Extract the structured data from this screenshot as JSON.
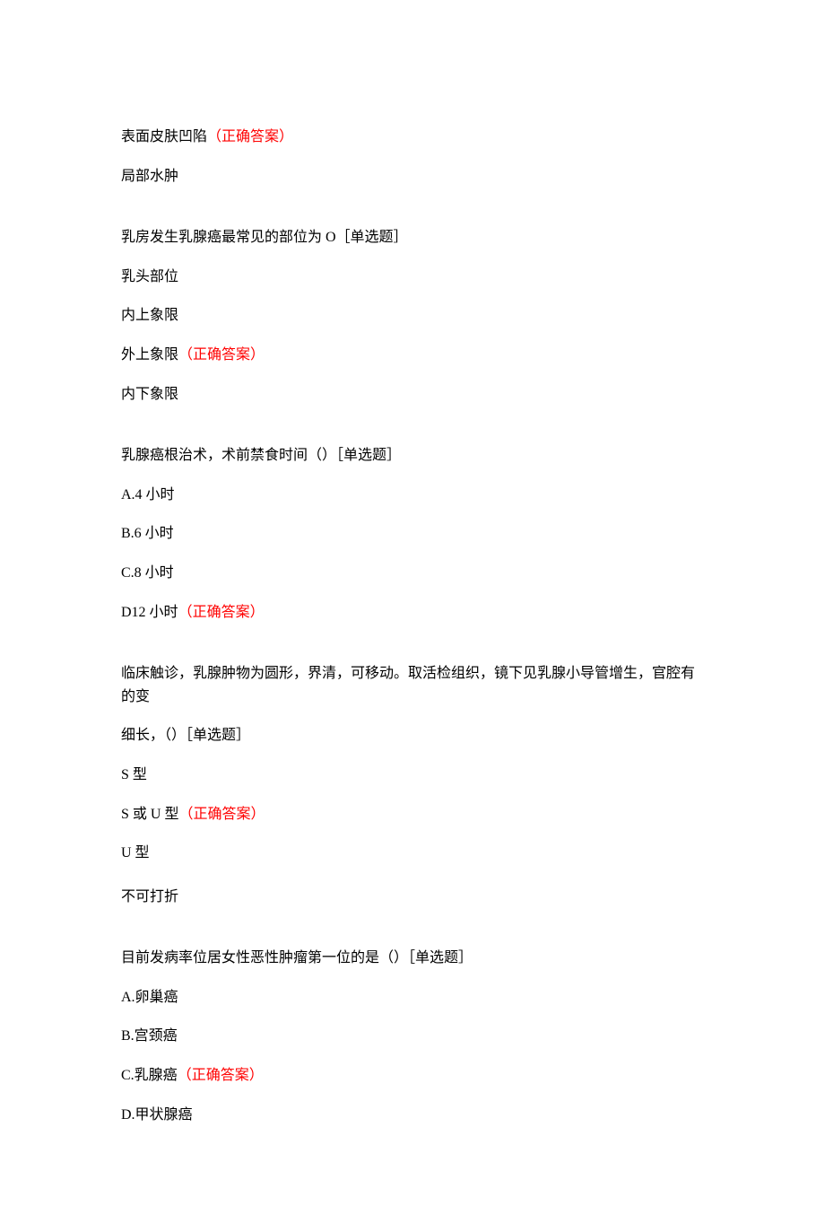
{
  "correct_label": "（正确答案）",
  "q0": {
    "options": [
      {
        "text": "表面皮肤凹陷",
        "correct": true
      },
      {
        "text": "局部水肿",
        "correct": false
      }
    ]
  },
  "q1": {
    "stem": "乳房发生乳腺癌最常见的部位为 O［单选题］",
    "options": [
      {
        "text": "乳头部位",
        "correct": false
      },
      {
        "text": "内上象限",
        "correct": false
      },
      {
        "text": "外上象限",
        "correct": true
      },
      {
        "text": "内下象限",
        "correct": false
      }
    ]
  },
  "q2": {
    "stem": "乳腺癌根治术，术前禁食时间（）［单选题］",
    "options": [
      {
        "text": "A.4 小时",
        "correct": false
      },
      {
        "text": "B.6 小时",
        "correct": false
      },
      {
        "text": "C.8 小时",
        "correct": false
      },
      {
        "text": "D12 小时",
        "correct": true
      }
    ]
  },
  "q3": {
    "stem_line1": "临床触诊，乳腺肿物为圆形，界清，可移动。取活检组织，镜下见乳腺小导管增生，官腔有的变",
    "stem_line2": "细长，（）［单选题］",
    "options": [
      {
        "text": "S 型",
        "correct": false
      },
      {
        "text": "S 或 U 型",
        "correct": true
      },
      {
        "text": "U 型",
        "correct": false
      },
      {
        "text": "不可打折",
        "correct": false
      }
    ]
  },
  "q4": {
    "stem": "目前发病率位居女性恶性肿瘤第一位的是（）［单选题］",
    "options": [
      {
        "text": "A.卵巢癌",
        "correct": false
      },
      {
        "text": "B.宫颈癌",
        "correct": false
      },
      {
        "text": "C.乳腺癌",
        "correct": true
      },
      {
        "text": "D.甲状腺癌",
        "correct": false
      }
    ]
  }
}
